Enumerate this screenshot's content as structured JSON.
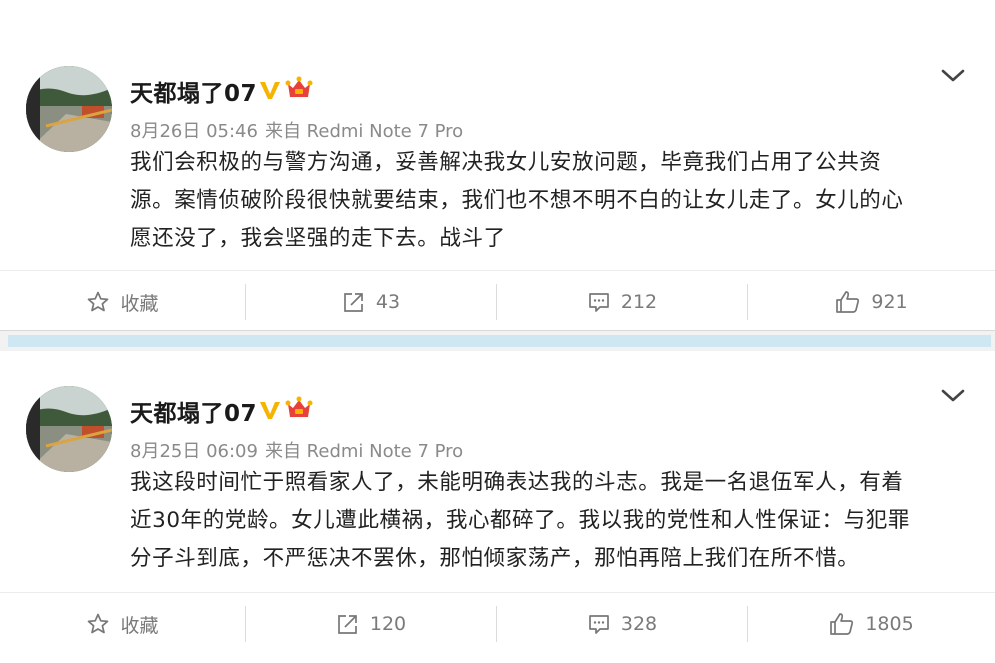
{
  "posts": [
    {
      "username": "天都塌了07",
      "date": "8月26日 05:46",
      "source": "来自 Redmi Note 7 Pro",
      "lines": [
        "我们会积极的与警方沟通，妥善解决我女儿安放问题，毕竟我们占用了公共资",
        "源。案情侦破阶段很快就要结束，我们也不想不明不白的让女儿走了。女儿的心",
        "愿还没了，我会坚强的走下去。战斗了"
      ],
      "actions": {
        "favorite_label": "收藏",
        "reposts": "43",
        "comments": "212",
        "likes": "921"
      }
    },
    {
      "username": "天都塌了07",
      "date": "8月25日 06:09",
      "source": "来自 Redmi Note 7 Pro",
      "lines": [
        "我这段时间忙于照看家人了，未能明确表达我的斗志。我是一名退伍军人，有着",
        "近30年的党龄。女儿遭此横祸，我心都碎了。我以我的党性和人性保证：与犯罪",
        "分子斗到底，不严惩决不罢休，那怕倾家荡产，那怕再陪上我们在所不惜。"
      ],
      "actions": {
        "favorite_label": "收藏",
        "reposts": "120",
        "comments": "328",
        "likes": "1805"
      }
    }
  ],
  "icons": {
    "verified": "verified-v-icon",
    "vip": "vip-crown-icon",
    "menu": "chevron-down-icon",
    "favorite": "star-icon",
    "repost": "share-arrow-icon",
    "comment": "comment-icon",
    "like": "thumbs-up-icon"
  },
  "colors": {
    "verified": "#f5b400",
    "vip": "#e8413b",
    "text": "#222222",
    "meta": "#8a8a8a",
    "separator": "#cfe7f3"
  }
}
